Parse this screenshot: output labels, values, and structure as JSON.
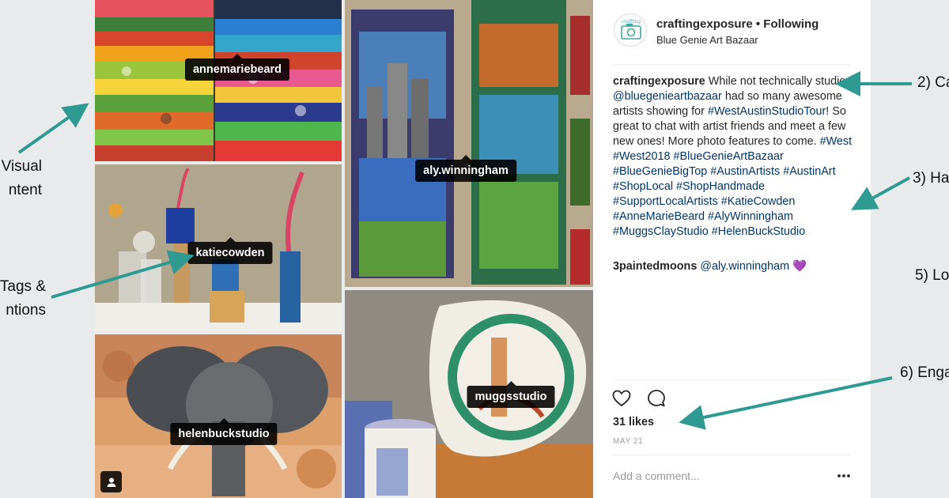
{
  "annotations": {
    "visual_content": [
      "Visual",
      "ntent"
    ],
    "tags_mentions": [
      "Tags &",
      "ntions"
    ],
    "caption": "2) Ca",
    "hashtags": "3) Ha",
    "location": "5) Lo",
    "engagement": "6) Enga"
  },
  "colors": {
    "arrow": "#2e9a92",
    "page_bg": "#e9eaec",
    "link": "#003569"
  },
  "photos": [
    {
      "subject": "fabric stacks",
      "tag": "annemariebeard"
    },
    {
      "subject": "mosaic panels",
      "tag": "aly.winningham"
    },
    {
      "subject": "wooden flowers and vases",
      "tag": "katiecowden"
    },
    {
      "subject": "ceramic platter and cups",
      "tag": "muggsstudio"
    },
    {
      "subject": "elephant painting",
      "tag": "helenbuckstudio"
    }
  ],
  "post": {
    "username": "craftingexposure",
    "follow_status": "Following",
    "location": "Blue Genie Art Bazaar",
    "avatar_text": "crafting",
    "caption_user": "craftingexposure",
    "caption_text_1": " While not technically studios, ",
    "caption_mention": "@bluegenieartbazaar",
    "caption_text_2": " had so many awesome artists showing for ",
    "caption_hashtag_1": "#WestAustinStudioTour",
    "caption_text_3": "! So great to chat with artist friends and meet a few new ones! More photo features to come. ",
    "hashtags": [
      "#West",
      "#West2018",
      "#BlueGenieArtBazaar",
      "#BlueGenieBigTop",
      "#AustinArtists",
      "#AustinArt",
      "#ShopLocal",
      "#ShopHandmade",
      "#SupportLocalArtists",
      "#KatieCowden",
      "#AnneMarieBeard",
      "#AlyWinningham",
      "#MuggsClayStudio",
      "#HelenBuckStudio"
    ],
    "comment_user": "3paintedmoons",
    "comment_mention": "@aly.winningham",
    "comment_emoji": "💜",
    "likes": "31 likes",
    "date": "MAY 21",
    "add_comment_placeholder": "Add a comment...",
    "icons": [
      "heart-icon",
      "comment-icon",
      "more-options-icon",
      "user-tag-icon"
    ]
  }
}
